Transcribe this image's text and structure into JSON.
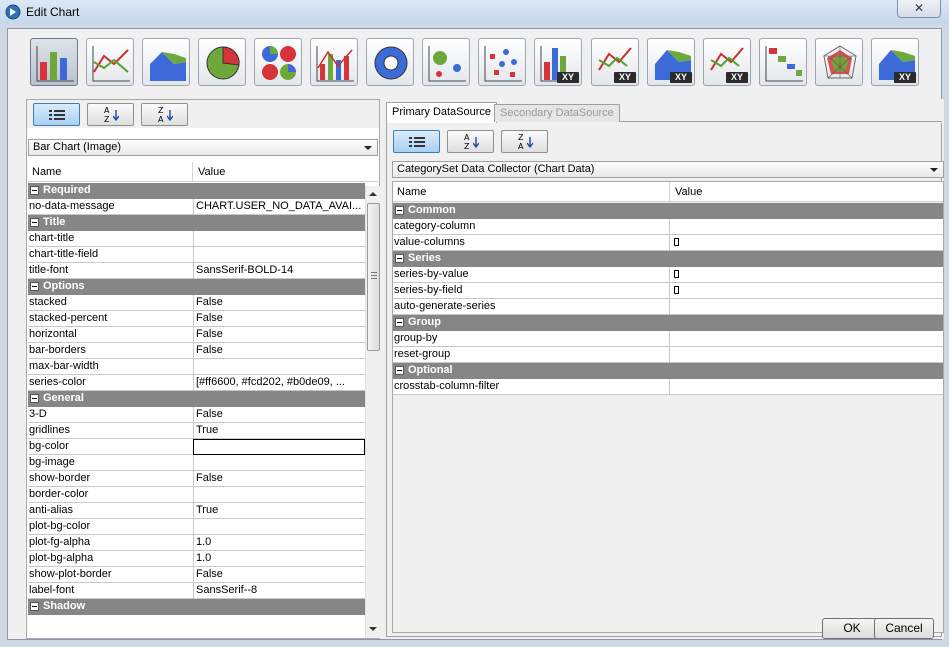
{
  "window": {
    "title": "Edit Chart",
    "close_glyph": "✕"
  },
  "toolbar": {
    "chart_types": [
      {
        "name": "bar-chart-icon",
        "xy": false,
        "selected": true
      },
      {
        "name": "line-chart-icon",
        "xy": false
      },
      {
        "name": "area-chart-icon",
        "xy": false
      },
      {
        "name": "pie-chart-icon",
        "xy": false
      },
      {
        "name": "multi-pie-chart-icon",
        "xy": false
      },
      {
        "name": "bar-line-chart-icon",
        "xy": false
      },
      {
        "name": "ring-chart-icon",
        "xy": false
      },
      {
        "name": "bubble-chart-icon",
        "xy": false
      },
      {
        "name": "scatter-chart-icon",
        "xy": false
      },
      {
        "name": "xy-bar-chart-icon",
        "xy": true
      },
      {
        "name": "xy-line-chart-icon",
        "xy": true
      },
      {
        "name": "xy-area-chart-icon",
        "xy": true
      },
      {
        "name": "xy-line-chart-2-icon",
        "xy": true
      },
      {
        "name": "waterfall-chart-icon",
        "xy": false
      },
      {
        "name": "radar-chart-icon",
        "xy": false
      },
      {
        "name": "xy-area-chart-2-icon",
        "xy": true
      }
    ],
    "xy_label": "XY"
  },
  "left": {
    "sort": {
      "categorized": "",
      "az_top": "A",
      "az_bottom": "Z",
      "za_top": "Z",
      "za_bottom": "A"
    },
    "chart_type_select": "Bar Chart (Image)",
    "columns": {
      "name": "Name",
      "value": "Value"
    },
    "rows": [
      {
        "group": "Required"
      },
      {
        "name": "no-data-message",
        "value": "CHART.USER_NO_DATA_AVAI..."
      },
      {
        "group": "Title"
      },
      {
        "name": "chart-title",
        "value": ""
      },
      {
        "name": "chart-title-field",
        "value": ""
      },
      {
        "name": "title-font",
        "value": "SansSerif-BOLD-14"
      },
      {
        "group": "Options"
      },
      {
        "name": "stacked",
        "value": "False"
      },
      {
        "name": "stacked-percent",
        "value": "False"
      },
      {
        "name": "horizontal",
        "value": "False"
      },
      {
        "name": "bar-borders",
        "value": "False"
      },
      {
        "name": "max-bar-width",
        "value": ""
      },
      {
        "name": "series-color",
        "value": "[#ff6600, #fcd202, #b0de09, ..."
      },
      {
        "group": "General"
      },
      {
        "name": "3-D",
        "value": "False"
      },
      {
        "name": "gridlines",
        "value": "True"
      },
      {
        "name": "bg-color",
        "value": "",
        "editing": true
      },
      {
        "name": "bg-image",
        "value": ""
      },
      {
        "name": "show-border",
        "value": "False"
      },
      {
        "name": "border-color",
        "value": ""
      },
      {
        "name": "anti-alias",
        "value": "True"
      },
      {
        "name": "plot-bg-color",
        "value": ""
      },
      {
        "name": "plot-fg-alpha",
        "value": "1.0"
      },
      {
        "name": "plot-bg-alpha",
        "value": "1.0"
      },
      {
        "name": "show-plot-border",
        "value": "False"
      },
      {
        "name": "label-font",
        "value": "SansSerif--8"
      },
      {
        "group": "Shadow"
      }
    ]
  },
  "right": {
    "tabs": [
      {
        "label": "Primary DataSource",
        "active": true
      },
      {
        "label": "Secondary DataSource",
        "active": false
      }
    ],
    "sort": {
      "az_top": "A",
      "az_bottom": "Z",
      "za_top": "Z",
      "za_bottom": "A"
    },
    "collector_select": "CategorySet Data Collector (Chart Data)",
    "columns": {
      "name": "Name",
      "value": "Value"
    },
    "rows": [
      {
        "group": "Common"
      },
      {
        "name": "category-column",
        "value": ""
      },
      {
        "name": "value-columns",
        "value": "[]",
        "bracket": true
      },
      {
        "group": "Series"
      },
      {
        "name": "series-by-value",
        "value": "[]",
        "bracket": true
      },
      {
        "name": "series-by-field",
        "value": "[]",
        "bracket": true
      },
      {
        "name": "auto-generate-series",
        "value": ""
      },
      {
        "group": "Group"
      },
      {
        "name": "group-by",
        "value": ""
      },
      {
        "name": "reset-group",
        "value": ""
      },
      {
        "group": "Optional"
      },
      {
        "name": "crosstab-column-filter",
        "value": ""
      }
    ]
  },
  "footer": {
    "ok": "OK",
    "cancel": "Cancel"
  },
  "colors": {
    "group_header": "#868686",
    "selected_sort": "#a9d0f2",
    "accent": "#3c7fb1"
  }
}
